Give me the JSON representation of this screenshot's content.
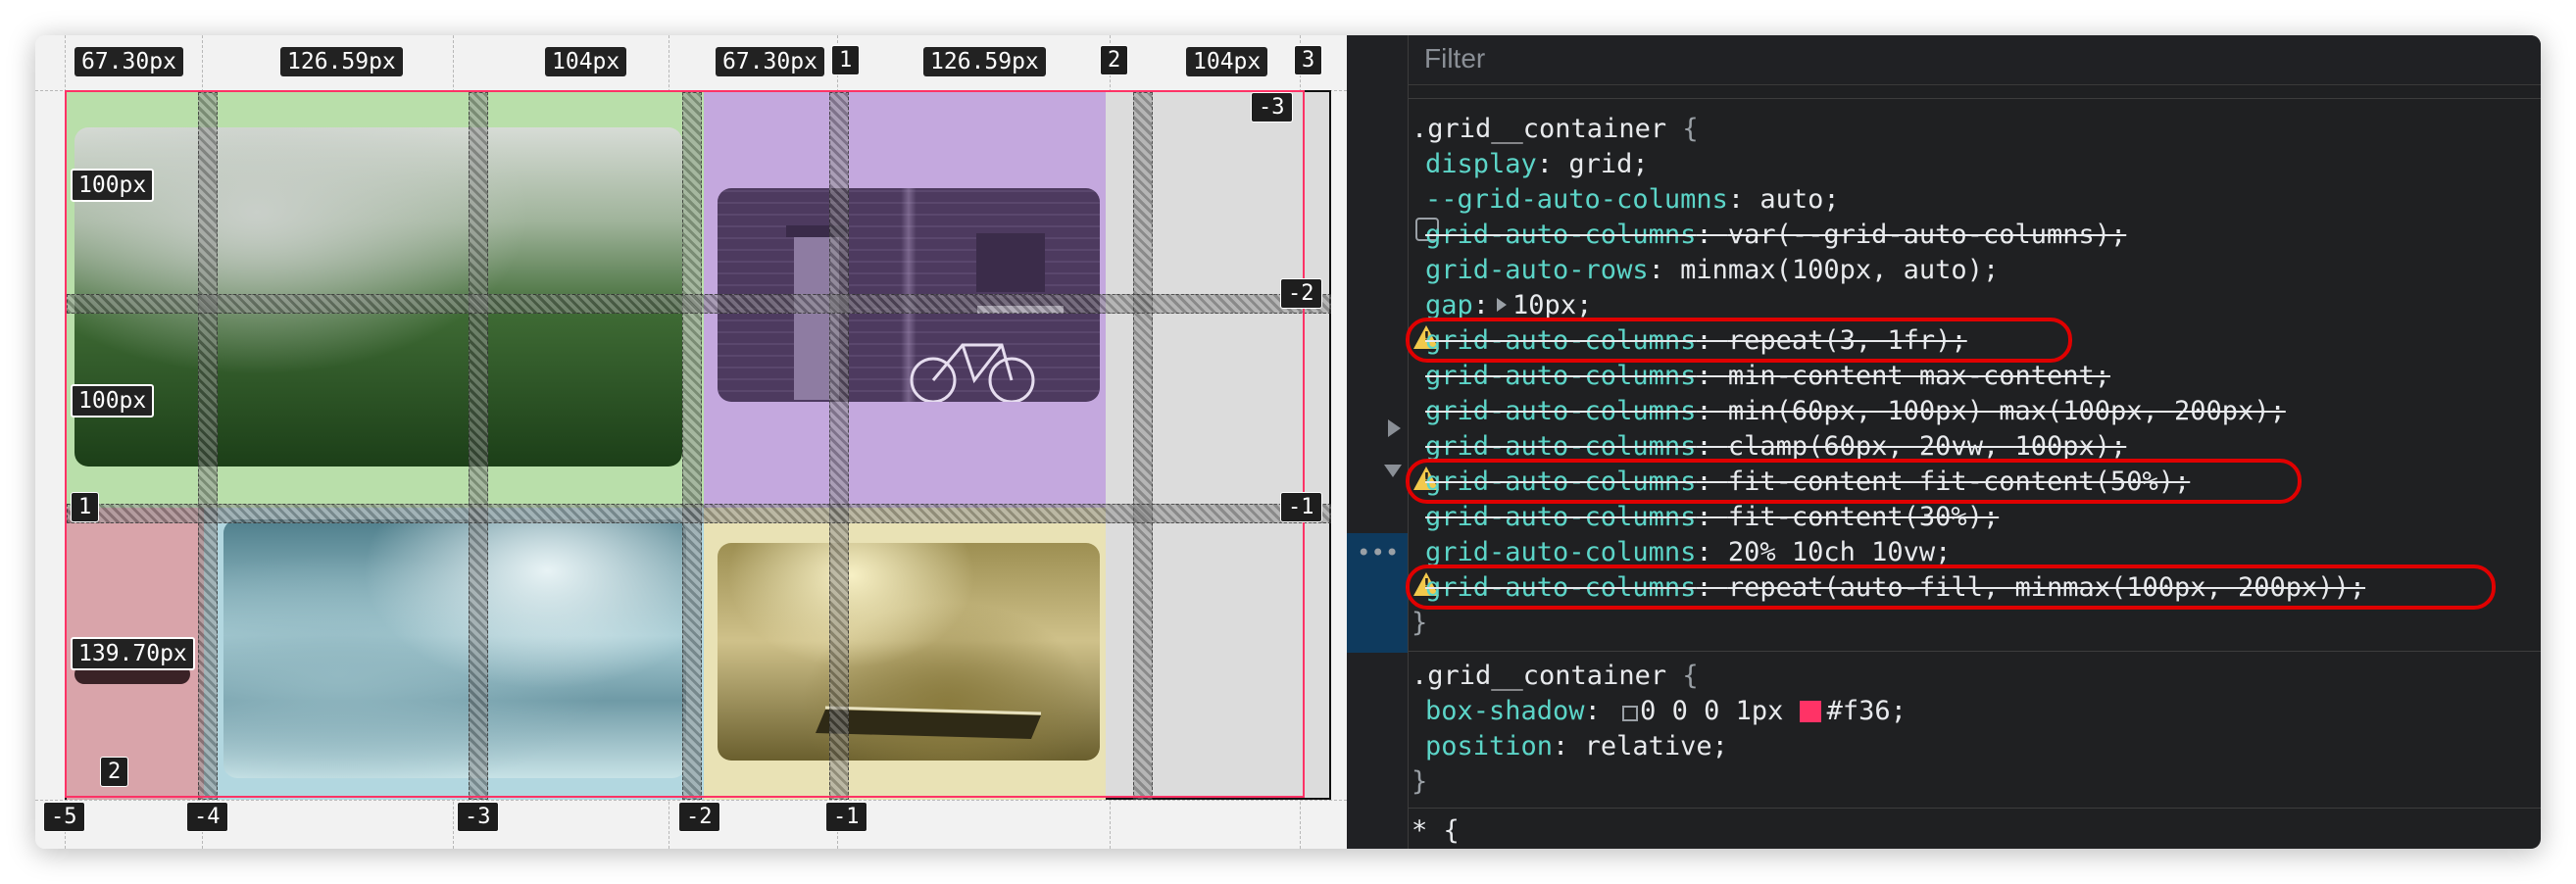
{
  "grid": {
    "col_labels_top": [
      "67.30px",
      "126.59px",
      "104px",
      "67.30px",
      "126.59px",
      "104px"
    ],
    "line_numbers_top": [
      "1",
      "2",
      "3"
    ],
    "line_number_neg_top_right": "-3",
    "row_labels": [
      "100px",
      "100px",
      "139.70px"
    ],
    "row_line_left": "1",
    "row_line_right_mid": "-2",
    "row_line_right_row": "-1",
    "bottom_left_number": "2",
    "line_numbers_bottom": [
      "-5",
      "-4",
      "-3",
      "-2",
      "-1"
    ],
    "colors": {
      "green": "#b9dfaa",
      "purple": "#c4a8de",
      "pink": "#d9a4aa",
      "blue": "#b2d7e0",
      "yellow": "#e9e2b5",
      "container_outline": "#ff3366"
    }
  },
  "devtools": {
    "filter_placeholder": "Filter",
    "rule1": {
      "selector": ".grid__container",
      "open": "{",
      "close": "}",
      "declarations": [
        {
          "prop": "display",
          "value": "grid;"
        },
        {
          "prop": "--grid-auto-columns",
          "value": "auto;"
        },
        {
          "prop": "grid-auto-columns",
          "value": "var(--grid-auto-columns);"
        },
        {
          "prop": "grid-auto-rows",
          "value": "minmax(100px, auto);"
        },
        {
          "prop": "gap",
          "value": "10px;"
        },
        {
          "prop": "grid-auto-columns",
          "value": "repeat(3, 1fr);"
        },
        {
          "prop": "grid-auto-columns",
          "value": "min-content max-content;"
        },
        {
          "prop": "grid-auto-columns",
          "value": "min(60px, 100px) max(100px, 200px);"
        },
        {
          "prop": "grid-auto-columns",
          "value": "clamp(60px, 20vw, 100px);"
        },
        {
          "prop": "grid-auto-columns",
          "value": "fit-content fit-content(50%);"
        },
        {
          "prop": "grid-auto-columns",
          "value": "fit-content(30%);"
        },
        {
          "prop": "grid-auto-columns",
          "value": "20% 10ch 10vw;"
        },
        {
          "prop": "grid-auto-columns",
          "value": "repeat(auto-fill, minmax(100px, 200px));"
        }
      ]
    },
    "rule2": {
      "selector": ".grid__container",
      "open": "{",
      "close": "}",
      "box_shadow_prop": "box-shadow",
      "box_shadow_value": "0 0 0 1px",
      "box_shadow_color": "#f36",
      "box_shadow_color_hex": "#ff3366",
      "position_prop": "position",
      "position_value": "relative;"
    },
    "rule3_selector": "* {",
    "gutter_ellipsis": "•••",
    "warning_icon": "warning-triangle-icon",
    "highlight_color": "#e00000"
  }
}
